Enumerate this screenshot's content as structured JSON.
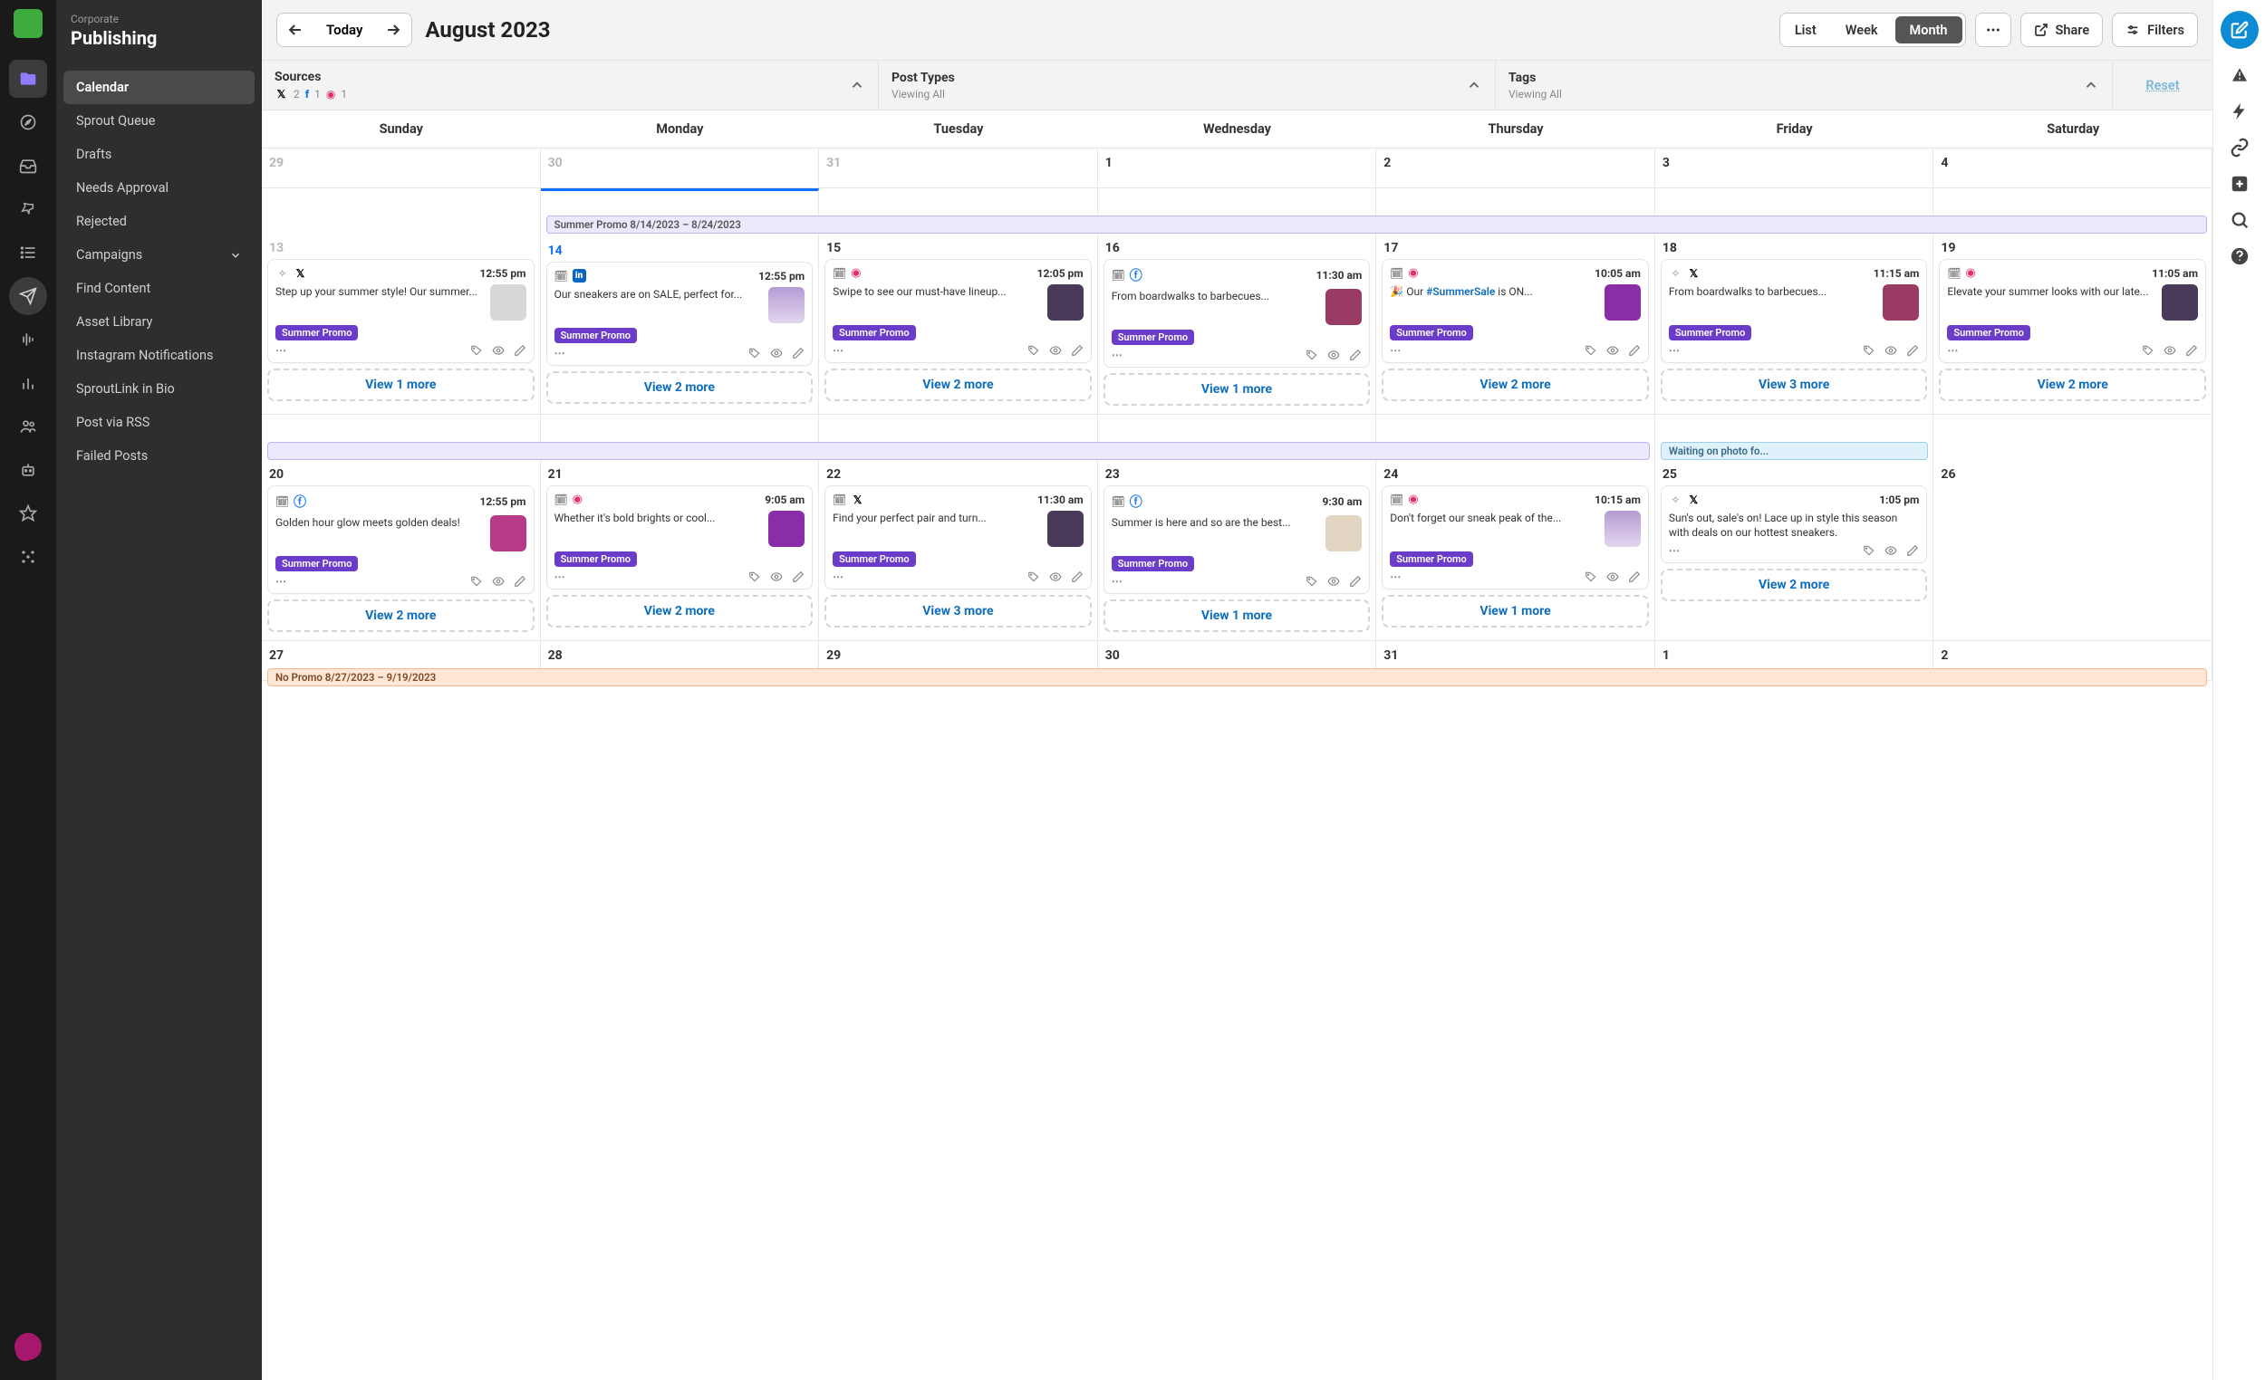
{
  "workspace": {
    "sub": "Corporate",
    "title": "Publishing"
  },
  "sidebar": {
    "items": [
      "Calendar",
      "Sprout Queue",
      "Drafts",
      "Needs Approval",
      "Rejected",
      "Campaigns",
      "Find Content",
      "Asset Library",
      "Instagram Notifications",
      "SproutLink in Bio",
      "Post via RSS",
      "Failed Posts"
    ],
    "activeIndex": 0,
    "expandableIndex": 5
  },
  "topbar": {
    "today": "Today",
    "title": "August 2023",
    "views": [
      "List",
      "Week",
      "Month"
    ],
    "activeView": 2,
    "share": "Share",
    "filters": "Filters"
  },
  "filters": {
    "reset": "Reset",
    "cells": [
      {
        "title": "Sources",
        "sub": "",
        "counts": {
          "x": "2",
          "fb": "1",
          "ig": "1"
        }
      },
      {
        "title": "Post Types",
        "sub": "Viewing All"
      },
      {
        "title": "Tags",
        "sub": "Viewing All"
      }
    ]
  },
  "dayHeaders": [
    "Sunday",
    "Monday",
    "Tuesday",
    "Wednesday",
    "Thursday",
    "Friday",
    "Saturday"
  ],
  "weeks": [
    {
      "span": null,
      "days": [
        {
          "num": "29",
          "dim": true
        },
        {
          "num": "30",
          "dim": true
        },
        {
          "num": "31",
          "dim": true
        },
        {
          "num": "1"
        },
        {
          "num": "2"
        },
        {
          "num": "3"
        },
        {
          "num": "4"
        }
      ]
    },
    {
      "span": {
        "cls": "purple",
        "text": "Summer Promo  8/14/2023 – 8/24/2023",
        "from": 1,
        "to": 7
      },
      "tall": true,
      "days": [
        {
          "num": "13",
          "dim": true,
          "card": {
            "icons": [
              "spark",
              "x"
            ],
            "time": "12:55 pm",
            "txt": "Step up your summer style! Our summer...",
            "tag": "Summer Promo",
            "thumb": "#d8d8d8"
          },
          "more": "View 1 more"
        },
        {
          "num": "14",
          "today": true,
          "card": {
            "icons": [
              "cal",
              "li"
            ],
            "time": "12:55 pm",
            "txt": "Our sneakers are on SALE, perfect for...",
            "tag": "Summer Promo",
            "thumb": "linear-gradient(#b59bd4,#e2d6ee)"
          },
          "more": "View 2 more"
        },
        {
          "num": "15",
          "card": {
            "icons": [
              "cal",
              "ig"
            ],
            "time": "12:05 pm",
            "txt": "Swipe to see our must-have lineup...",
            "tag": "Summer Promo",
            "thumb": "#4a3a5a"
          },
          "more": "View 2 more"
        },
        {
          "num": "16",
          "card": {
            "icons": [
              "cal",
              "fb"
            ],
            "time": "11:30 am",
            "txt": "From boardwalks to barbecues...",
            "tag": "Summer Promo",
            "thumb": "#9a3b64"
          },
          "more": "View 1 more"
        },
        {
          "num": "17",
          "card": {
            "icons": [
              "cal",
              "ig"
            ],
            "time": "10:05 am",
            "txt": "🎉 Our #SummerSale is ON...",
            "txtHtml": "🎉 Our <span style='color:#106ebe;font-weight:600'>#SummerSale</span> is ON...",
            "tag": "Summer Promo",
            "thumb": "#8a2da8"
          },
          "more": "View 2 more"
        },
        {
          "num": "18",
          "card": {
            "icons": [
              "spark",
              "x"
            ],
            "time": "11:15 am",
            "txt": "From boardwalks to barbecues...",
            "tag": "Summer Promo",
            "thumb": "#9a3b64"
          },
          "more": "View 3 more"
        },
        {
          "num": "19",
          "card": {
            "icons": [
              "cal",
              "ig"
            ],
            "time": "11:05 am",
            "txt": "Elevate your summer looks with our late...",
            "tag": "Summer Promo",
            "thumb": "#4a3a5a"
          },
          "more": "View 2 more"
        }
      ]
    },
    {
      "span": {
        "cls": "purple",
        "text": "",
        "from": 0,
        "to": 5
      },
      "extraSpan": {
        "cls": "blue",
        "text": "Waiting on photo fo...",
        "from": 5,
        "to": 6
      },
      "tall": true,
      "days": [
        {
          "num": "20",
          "card": {
            "icons": [
              "cal",
              "fb"
            ],
            "time": "12:55 pm",
            "txt": "Golden hour glow meets golden deals!",
            "tag": "Summer Promo",
            "thumb": "#b73a89"
          },
          "more": "View 2 more"
        },
        {
          "num": "21",
          "card": {
            "icons": [
              "cal",
              "ig"
            ],
            "time": "9:05 am",
            "txt": "Whether it's bold brights or cool...",
            "tag": "Summer Promo",
            "thumb": "#8a2da8"
          },
          "more": "View 2 more"
        },
        {
          "num": "22",
          "card": {
            "icons": [
              "cal",
              "x"
            ],
            "time": "11:30 am",
            "txt": "Find your perfect pair and turn...",
            "tag": "Summer Promo",
            "thumb": "#4a3a5a"
          },
          "more": "View 3 more"
        },
        {
          "num": "23",
          "card": {
            "icons": [
              "cal",
              "fb"
            ],
            "time": "9:30 am",
            "txt": "Summer is here and so are the best...",
            "tag": "Summer Promo",
            "thumb": "#e2d6c2"
          },
          "more": "View 1 more"
        },
        {
          "num": "24",
          "card": {
            "icons": [
              "cal",
              "ig"
            ],
            "time": "10:15 am",
            "txt": "Don't forget our sneak peak of the...",
            "tag": "Summer Promo",
            "thumb": "linear-gradient(#b59bd4,#e2d6ee)"
          },
          "more": "View 1 more"
        },
        {
          "num": "25",
          "card": {
            "icons": [
              "spark",
              "x"
            ],
            "time": "1:05 pm",
            "txt": "Sun's out, sale's on! Lace up in style this season with deals on our hottest sneakers.",
            "notag": true
          },
          "more": "View 2 more"
        },
        {
          "num": "26"
        }
      ]
    },
    {
      "span": {
        "cls": "orange",
        "text": "No Promo 8/27/2023 – 9/19/2023",
        "from": 0,
        "to": 7
      },
      "days": [
        {
          "num": "27"
        },
        {
          "num": "28"
        },
        {
          "num": "29"
        },
        {
          "num": "30"
        },
        {
          "num": "31"
        },
        {
          "num": "1"
        },
        {
          "num": "2"
        }
      ]
    }
  ]
}
